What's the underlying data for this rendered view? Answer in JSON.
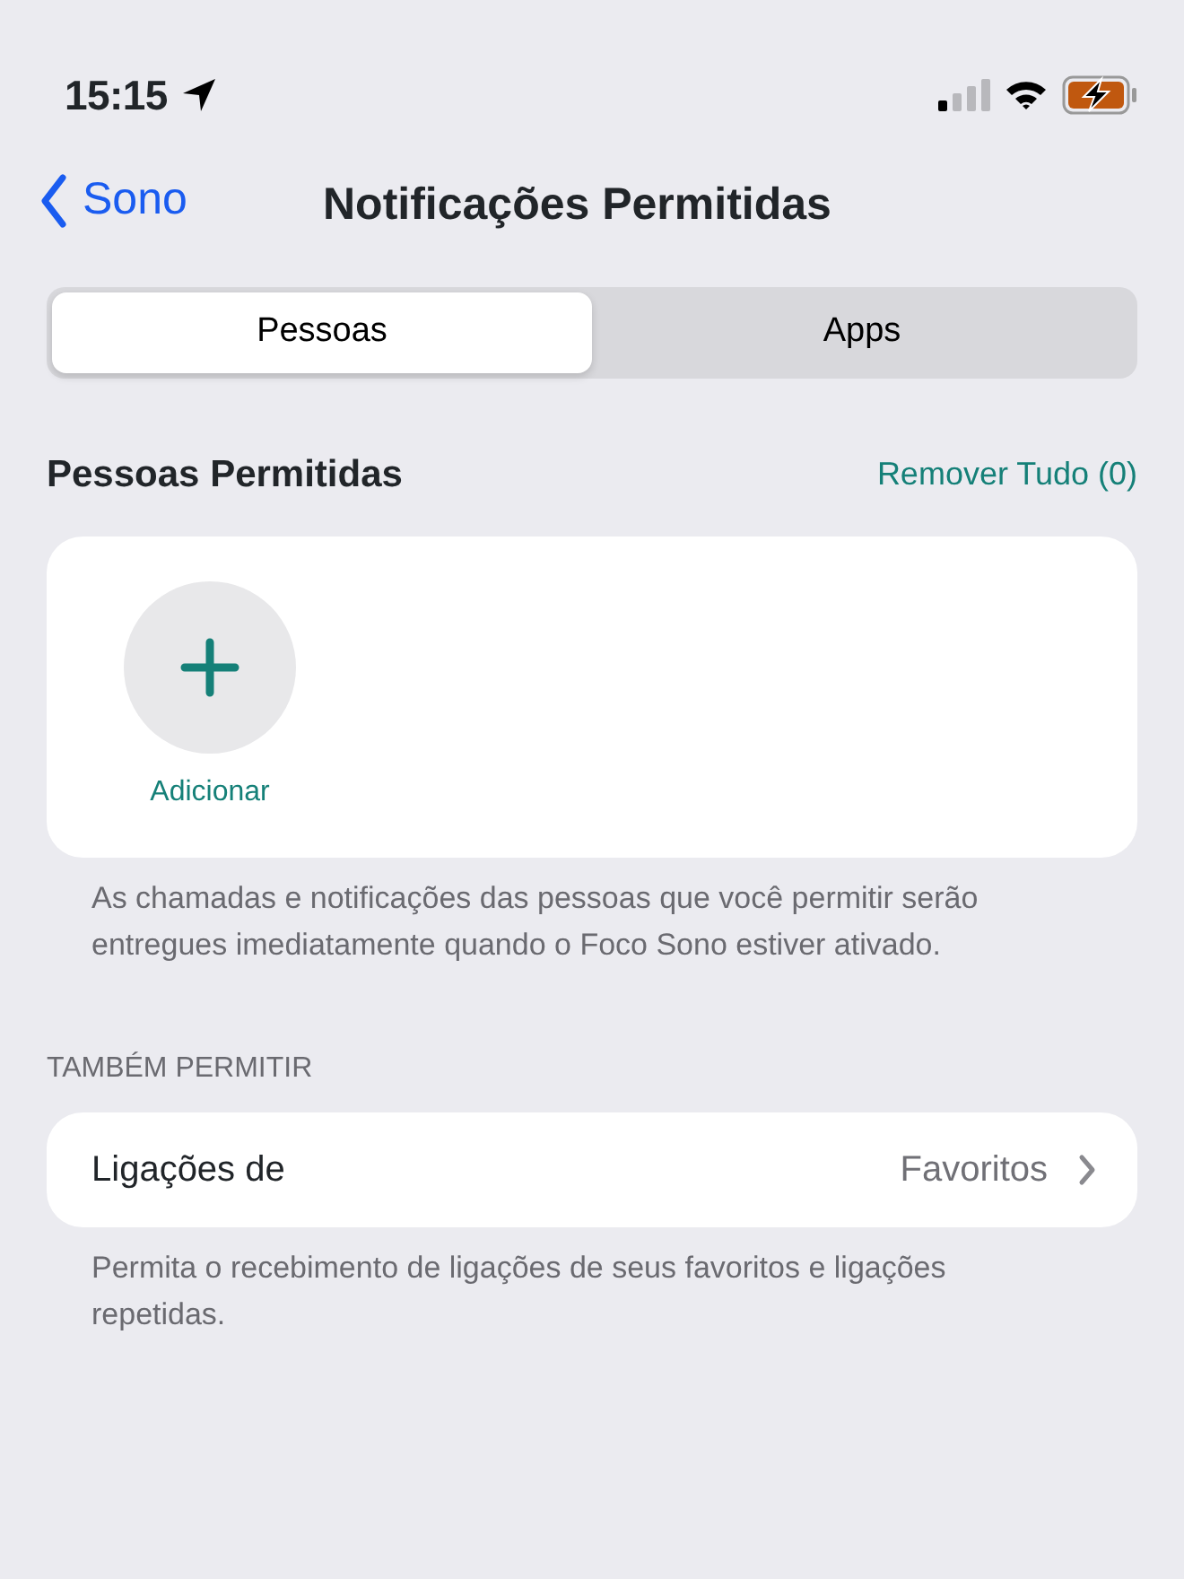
{
  "status_bar": {
    "time": "15:15",
    "battery_charging": true
  },
  "nav": {
    "back": "Sono",
    "title": "Notificações Permitidas"
  },
  "tabs": [
    {
      "label": "Pessoas",
      "selected": true
    },
    {
      "label": "Apps",
      "selected": false
    }
  ],
  "people_section": {
    "title": "Pessoas Permitidas",
    "action": "Remover Tudo (0)",
    "add_label": "Adicionar",
    "footer": "As chamadas e notificações das pessoas que você permitir serão entregues imediatamente quando o Foco Sono estiver ativado."
  },
  "also_section": {
    "header": "TAMBÉM PERMITIR",
    "rows": [
      {
        "label": "Ligações de",
        "value": "Favoritos"
      }
    ],
    "footer": "Permita o recebimento de ligações de seus favoritos e ligações repetidas."
  }
}
